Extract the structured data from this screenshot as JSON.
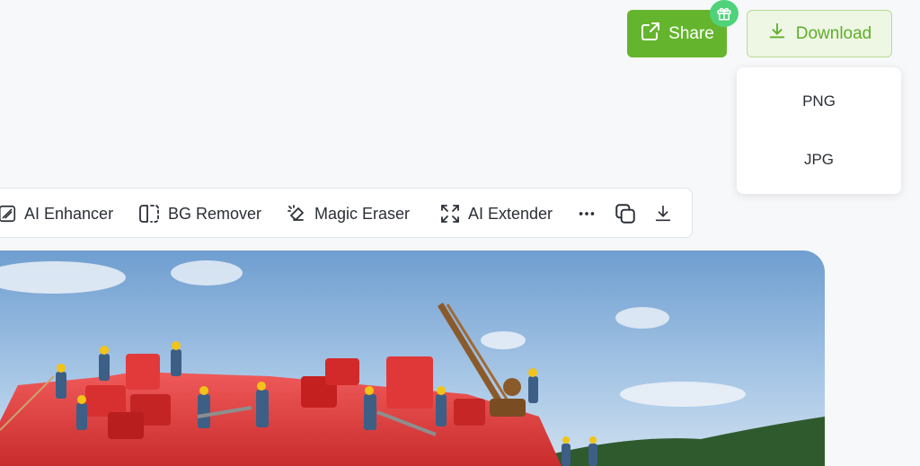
{
  "header": {
    "share_label": "Share",
    "download_label": "Download",
    "share_icon": "share-icon",
    "gift_icon": "gift-icon",
    "download_icon": "download-icon"
  },
  "download_menu": {
    "options": [
      "PNG",
      "JPG"
    ]
  },
  "toolbar": {
    "tools": [
      {
        "label": "AI Enhancer",
        "icon": "enhancer-icon"
      },
      {
        "label": "BG Remover",
        "icon": "bg-remover-icon"
      },
      {
        "label": "Magic Eraser",
        "icon": "eraser-icon"
      },
      {
        "label": "AI Extender",
        "icon": "expand-icon"
      }
    ],
    "more_icon": "more-icon",
    "copy_icon": "copy-icon",
    "download_icon": "download-icon"
  },
  "colors": {
    "accent_green": "#64b52d",
    "download_bg": "#eef6e4",
    "badge_green": "#4fd27a"
  }
}
